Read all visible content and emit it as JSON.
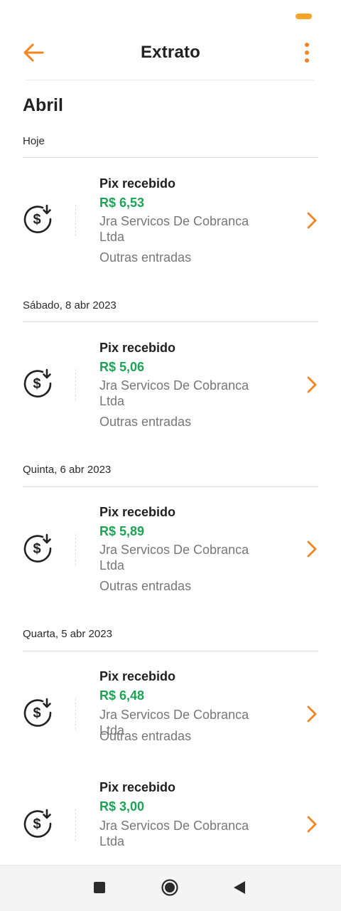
{
  "header": {
    "title": "Extrato"
  },
  "month": "Abril",
  "days": [
    {
      "label": "Hoje",
      "tx": {
        "type": "Pix recebido",
        "amount": "R$ 6,53",
        "description": "Jra Servicos De Cobranca Ltda",
        "category": "Outras entradas"
      }
    },
    {
      "label": "Sábado, 8 abr 2023",
      "tx": {
        "type": "Pix recebido",
        "amount": "R$ 5,06",
        "description": "Jra Servicos De Cobranca Ltda",
        "category": "Outras entradas"
      }
    },
    {
      "label": "Quinta, 6 abr 2023",
      "tx": {
        "type": "Pix recebido",
        "amount": "R$ 5,89",
        "description": "Jra Servicos De Cobranca Ltda",
        "category": "Outras entradas"
      }
    },
    {
      "label": "Quarta, 5 abr 2023",
      "tx": {
        "type": "Pix recebido",
        "amount": "R$ 6,48",
        "description": "Jra Servicos De Cobranca Ltda",
        "category": "Outras entradas"
      }
    }
  ],
  "extra_tx": {
    "type": "Pix recebido",
    "amount": "R$ 3,00",
    "description": "Jra Servicos De Cobranca Ltda"
  },
  "colors": {
    "accent": "#f7831f",
    "amount_green": "#1aa555"
  },
  "icons": {
    "back": "arrow-left-icon",
    "more": "more-vertical-icon",
    "tx": "money-in-icon",
    "chevron": "chevron-right-icon"
  }
}
